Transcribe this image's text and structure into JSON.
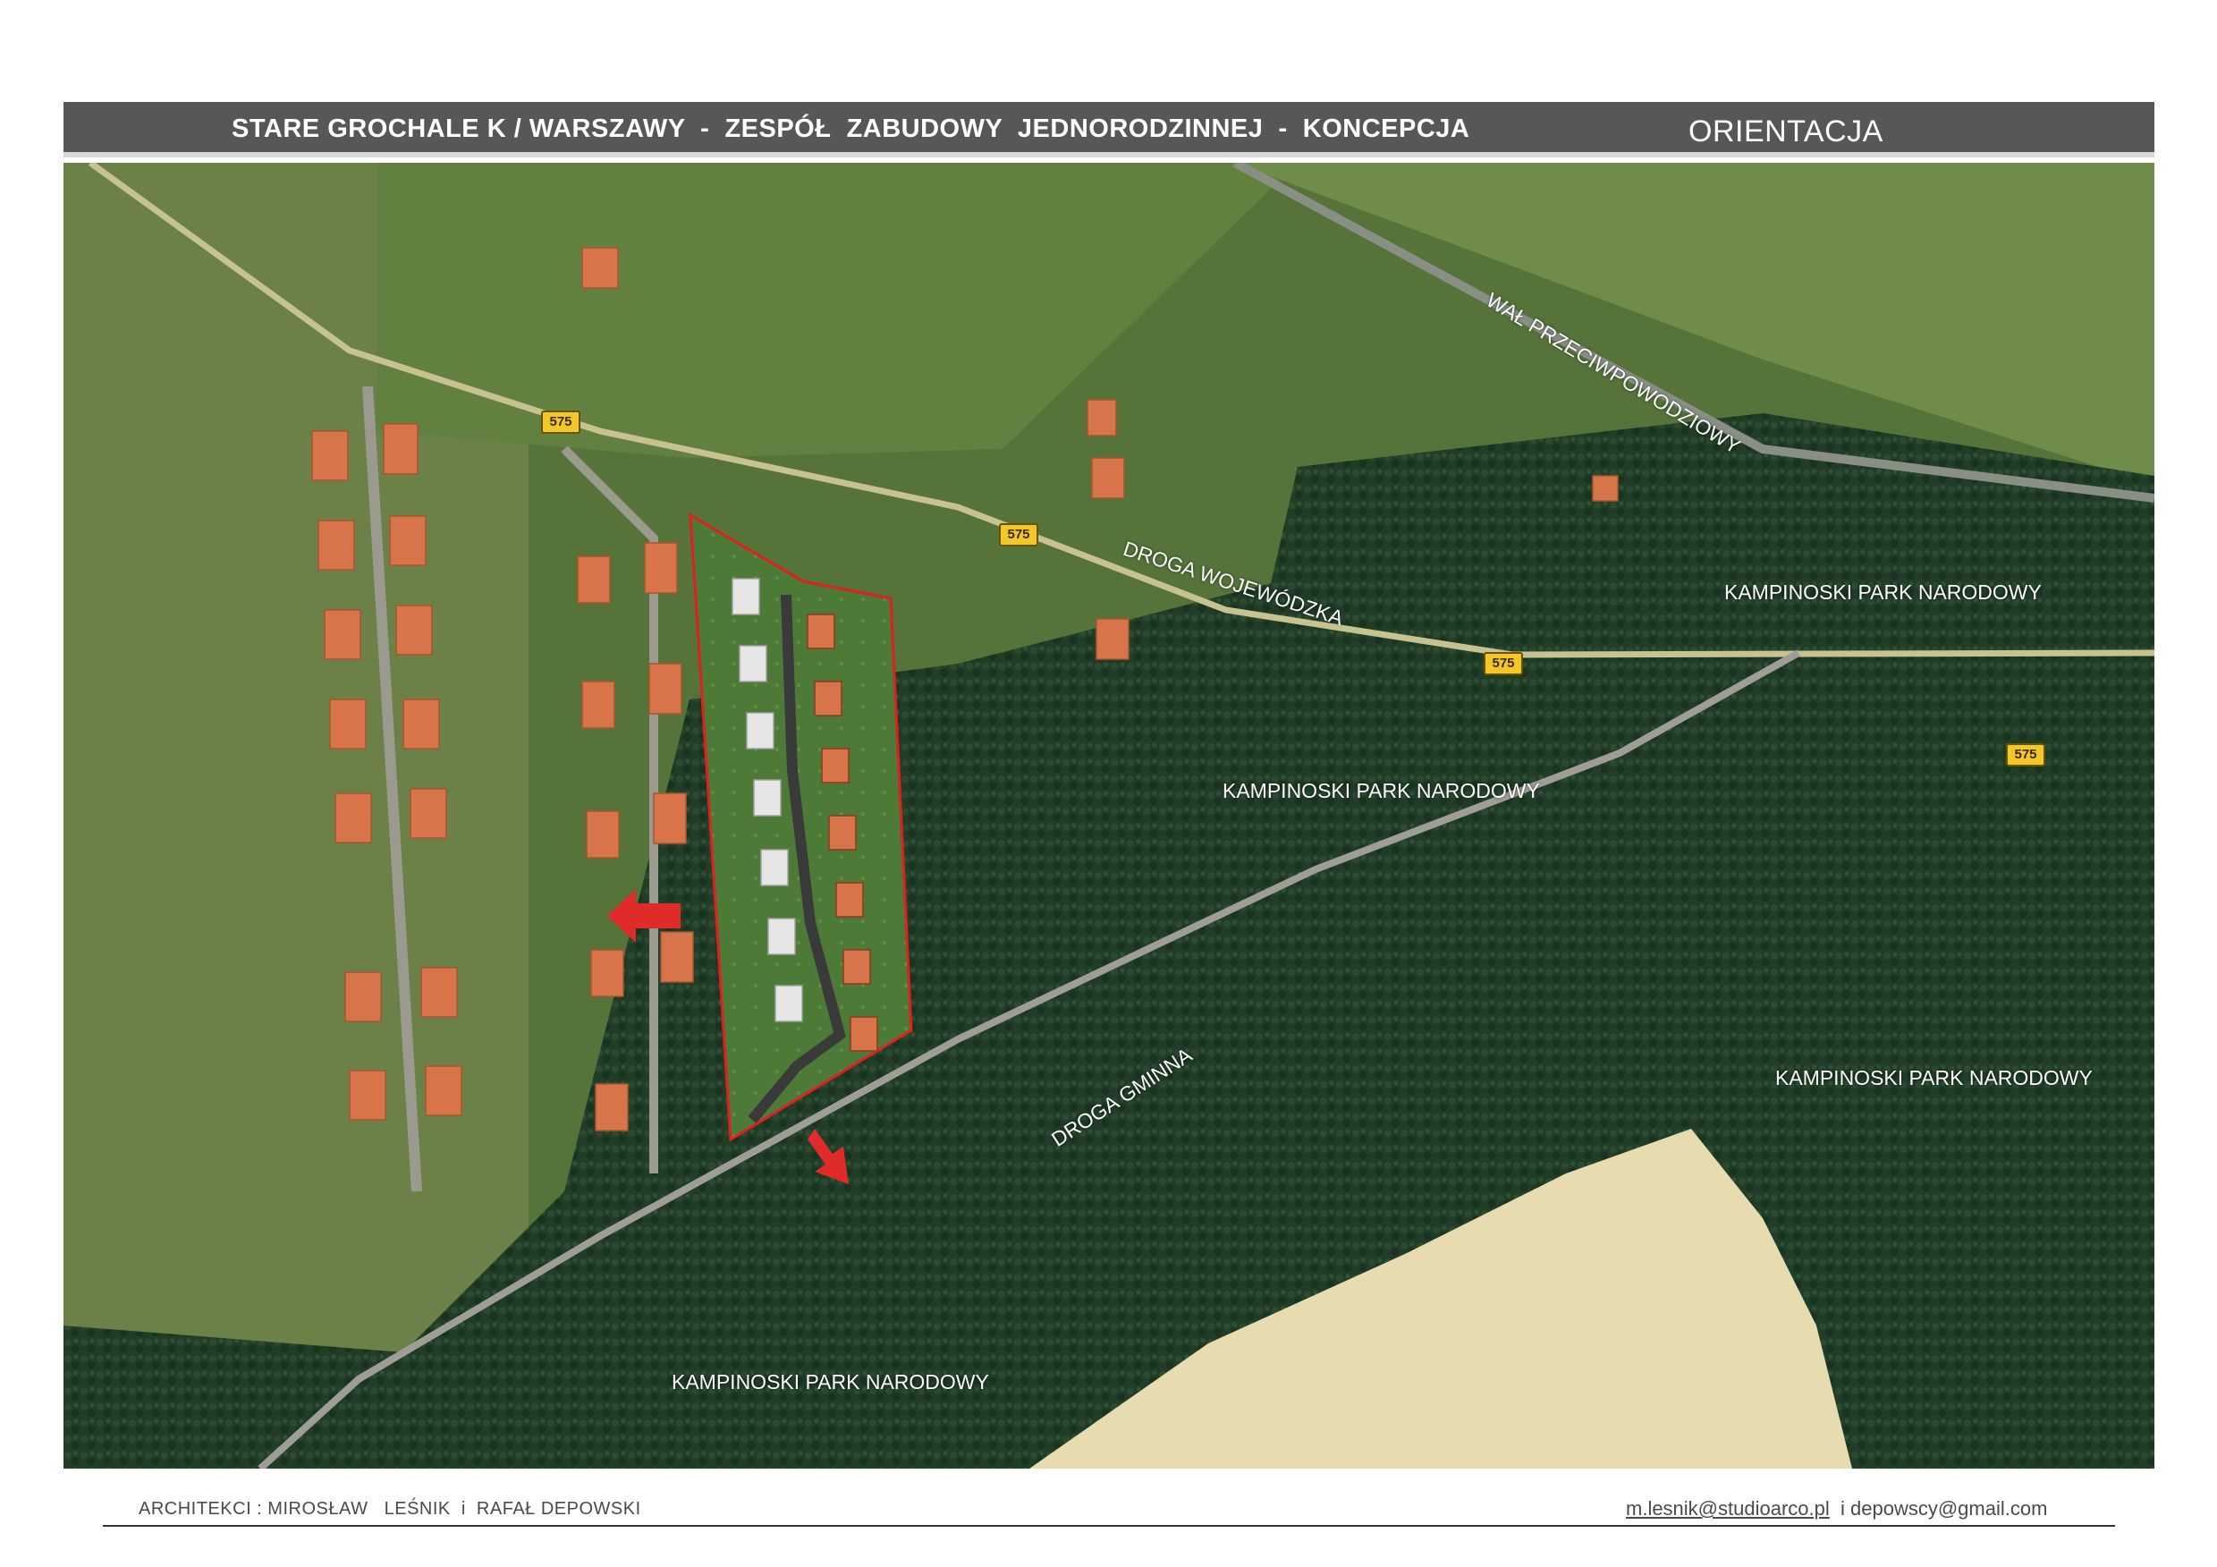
{
  "header": {
    "title": "STARE GROCHALE K / WARSZAWY  -  ZESPÓŁ  ZABUDOWY  JEDNORODZINNEJ  -  KONCEPCJA",
    "section": "ORIENTACJA"
  },
  "map": {
    "labels": {
      "flood_embankment": "WAŁ PRZECIWPOWODZIOWY",
      "voivodeship_road": "DROGA WOJEWÓDZKA",
      "municipal_road": "DROGA GMINNA",
      "park_1": "KAMPINOSKI PARK NARODOWY",
      "park_2": "KAMPINOSKI PARK NARODOWY",
      "park_3": "KAMPINOSKI PARK NARODOWY",
      "park_4": "KAMPINOSKI PARK NARODOWY"
    },
    "road_number": "575",
    "colors": {
      "boundary": "#e02020",
      "arrow": "#e02b2b",
      "road_badge": "#f3c62a",
      "forest": "#1f3b25",
      "meadow": "#5b7a3a",
      "sand": "#e6dcb0"
    }
  },
  "footer": {
    "architects": "ARCHITEKCI : MIROSŁAW   LEŚNIK  i  RAFAŁ DEPOWSKI",
    "email_1": "m.lesnik@studioarco.pl",
    "email_sep": "  i ",
    "email_2": "depowscy@gmail.com"
  }
}
